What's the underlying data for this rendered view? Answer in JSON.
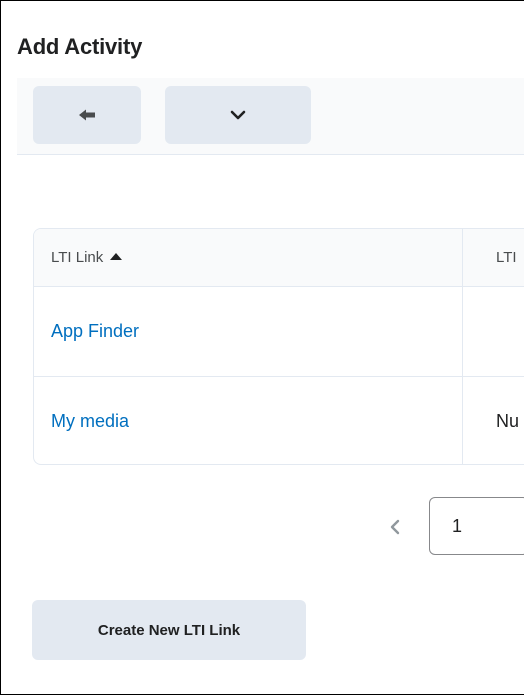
{
  "page": {
    "title": "Add Activity"
  },
  "toolbar": {
    "back_icon": "arrow-left-icon",
    "more_icon": "chevron-down-icon"
  },
  "table": {
    "columns": [
      {
        "label": "LTI Link",
        "sort": "ascending"
      },
      {
        "label": "LTI"
      }
    ],
    "rows": [
      {
        "link": "App Finder",
        "col2": ""
      },
      {
        "link": "My media",
        "col2": "Nu"
      }
    ]
  },
  "pagination": {
    "prev_icon": "chevron-left-icon",
    "page_value": "1"
  },
  "actions": {
    "create_label": "Create New LTI Link"
  },
  "colors": {
    "link": "#006fbf",
    "button_bg": "#e3e9f1",
    "text": "#202122"
  }
}
